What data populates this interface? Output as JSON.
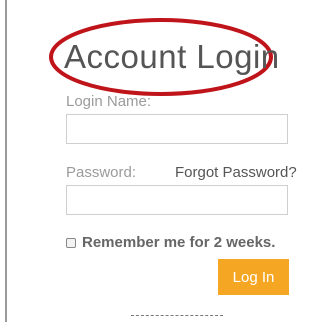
{
  "form": {
    "title": "Account Login",
    "login_label": "Login Name:",
    "login_value": "",
    "password_label": "Password:",
    "password_value": "",
    "forgot_link": "Forgot Password?",
    "remember_label": "Remember me for 2 weeks.",
    "remember_checked": false,
    "submit_label": "Log In"
  },
  "colors": {
    "accent": "#f5a623",
    "annotation": "#c0141b"
  }
}
